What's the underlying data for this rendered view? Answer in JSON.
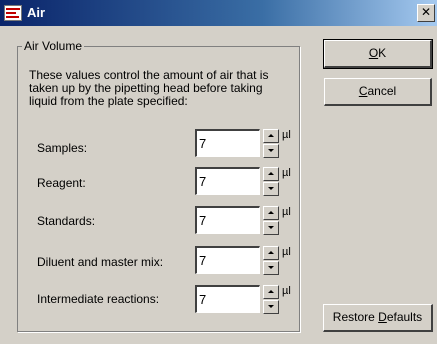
{
  "window": {
    "title": "Air",
    "close_glyph": "✕",
    "icon": "air-app-icon"
  },
  "group": {
    "title": "Air Volume",
    "description": "These values control the amount of air that is taken up by the pipetting head before taking liquid from the plate specified:"
  },
  "fields": [
    {
      "label": "Samples:",
      "value": "7",
      "unit": "µl"
    },
    {
      "label": "Reagent:",
      "value": "7",
      "unit": "µl"
    },
    {
      "label": "Standards:",
      "value": "7",
      "unit": "µl"
    },
    {
      "label": "Diluent and master mix:",
      "value": "7",
      "unit": "µl"
    },
    {
      "label": "Intermediate reactions:",
      "value": "7",
      "unit": "µl"
    }
  ],
  "buttons": {
    "ok_mnemonic": "O",
    "ok_rest": "K",
    "cancel_mnemonic": "C",
    "cancel_rest": "ancel",
    "restore_prefix": "Restore ",
    "restore_mnemonic": "D",
    "restore_rest": "efaults"
  },
  "colors": {
    "titlebar_start": "#0a246a",
    "titlebar_end": "#a6caf0",
    "dialog_face": "#d4d0c8"
  }
}
